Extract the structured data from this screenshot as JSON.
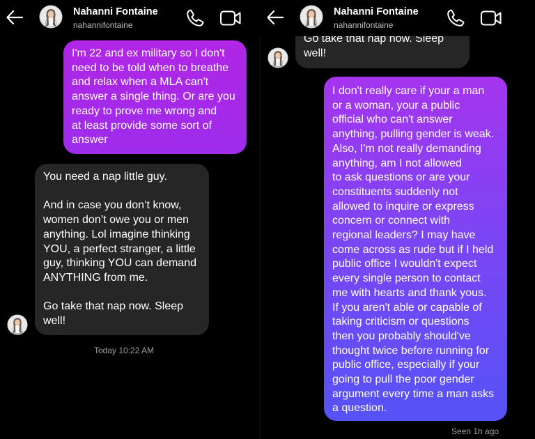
{
  "contact": {
    "name": "Nahanni Fontaine",
    "username": "nahannifontaine"
  },
  "left_panel": {
    "messages": [
      {
        "type": "sent",
        "text": "I'm 22 and ex military so I don't\nneed to be told when to breathe\nand relax when a MLA can't\nanswer a single thing. Or are you\nready to prove me wrong and\nat least provide some sort of\nanswer"
      },
      {
        "type": "received",
        "text": "You need a nap little guy.\n\nAnd in case you don’t know,\nwomen don’t owe you or men\nanything. Lol imagine thinking\nYOU, a perfect stranger, a little\nguy, thinking YOU can demand\nANYTHING from me.\n\nGo take that nap now. Sleep\nwell!"
      }
    ],
    "timestamp": "Today 10:22 AM"
  },
  "right_panel": {
    "messages": [
      {
        "type": "received",
        "text": "Go take that nap now. Sleep\nwell!"
      },
      {
        "type": "sent",
        "text": "I don't really care if your a man\nor a woman, your a public\nofficial who can't answer\nanything, pulling gender is weak.\nAlso, I'm not really demanding\nanything, am I not allowed\nto ask questions or are your\nconstituents suddenly not\nallowed to inquire or express\nconcern or connect with\nregional leaders? I may have\ncome across as rude but if I held\npublic office I wouldn't expect\nevery single person to contact\nme with hearts and thank yous.\nIf you aren't able or capable of\ntaking criticism or questions\nthen you probably should've\nthought twice before running for\npublic office, especially if your\ngoing to pull the poor gender\nargument every time a man asks\na question."
      }
    ],
    "seen_status": "Seen 1h ago"
  },
  "icons": {
    "back": "arrow-left-icon",
    "call": "phone-icon",
    "video": "video-camera-icon",
    "avatar": "profile-avatar"
  },
  "colors": {
    "background": "#000000",
    "received_bubble": "#262626",
    "sent_bubble_top": "#b126e6",
    "sent_bubble_bottom": "#5552f6",
    "meta_text": "#a0a0a0"
  }
}
